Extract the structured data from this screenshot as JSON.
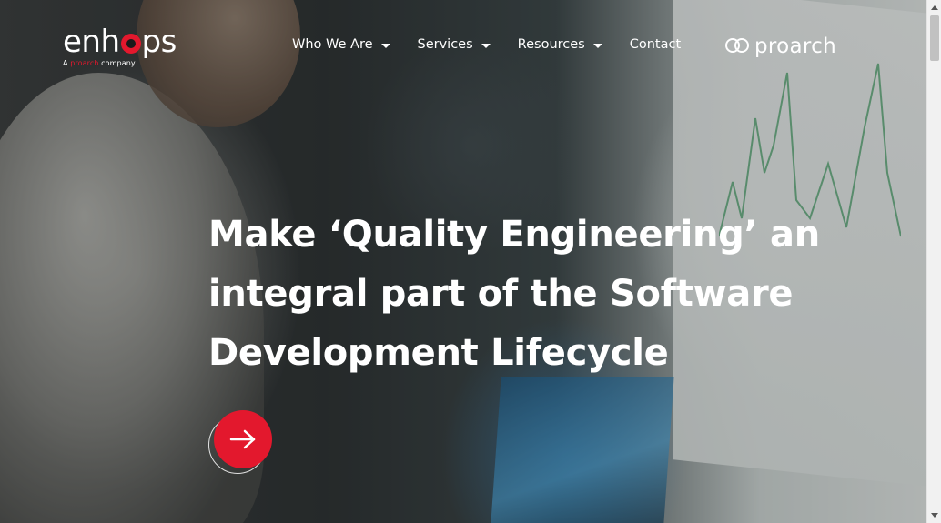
{
  "brand": {
    "logo_prefix": "enh",
    "logo_suffix": "ps",
    "tagline_prefix": "A ",
    "tagline_brand": "proarch",
    "tagline_suffix": " company",
    "accent_color": "#e3182d"
  },
  "nav": {
    "items": [
      {
        "label": "Who We Are",
        "has_dropdown": true
      },
      {
        "label": "Services",
        "has_dropdown": true
      },
      {
        "label": "Resources",
        "has_dropdown": true
      },
      {
        "label": "Contact",
        "has_dropdown": false
      }
    ]
  },
  "partner": {
    "name": "proarch",
    "icon": "proarch-logo-icon"
  },
  "hero": {
    "headline_line1": "Make ‘Quality Engineering’ an",
    "headline_line2": "integral part of the Software",
    "headline_line3": "Development Lifecycle",
    "cta_icon": "arrow-right-icon"
  },
  "scrollbar": {
    "icons": [
      "scroll-up-icon",
      "scroll-down-icon"
    ]
  }
}
